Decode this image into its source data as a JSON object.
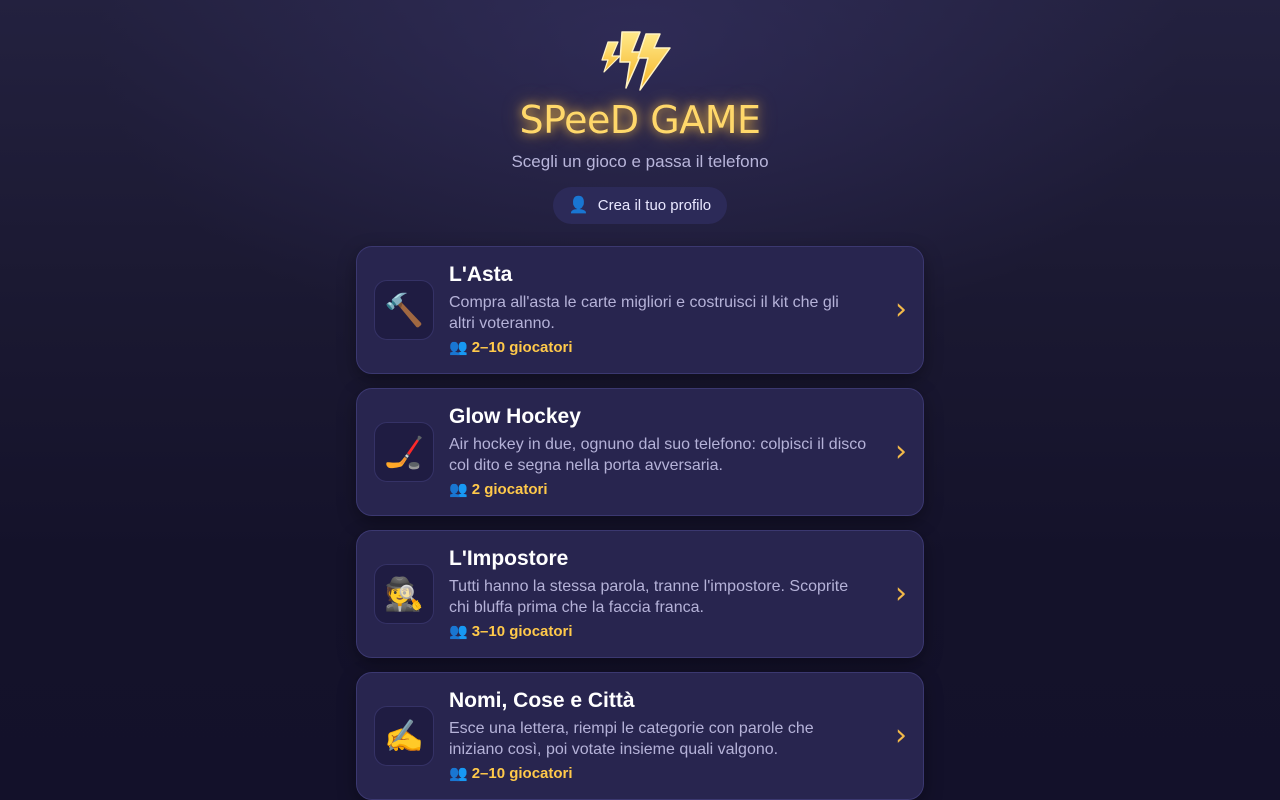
{
  "header": {
    "logo_icon": "lightning-bolt-icon",
    "title": "SPeeD GAME",
    "subtitle": "Scegli un gioco e passa il telefono",
    "accent_color": "#ffd86a"
  },
  "profile": {
    "icon": "👤",
    "label": "Crea il tuo profilo"
  },
  "games": [
    {
      "icon": "🔨",
      "icon_name": "hammer-icon",
      "title": "L'Asta",
      "description": "Compra all'asta le carte migliori e costruisci il kit che gli altri voteranno.",
      "players_icon": "👥",
      "players": "2–10 giocatori"
    },
    {
      "icon": "🏒",
      "icon_name": "hockey-stick-icon",
      "title": "Glow Hockey",
      "description": "Air hockey in due, ognuno dal suo telefono: colpisci il disco col dito e segna nella porta avversaria.",
      "players_icon": "👥",
      "players": "2 giocatori"
    },
    {
      "icon": "🕵️",
      "icon_name": "detective-icon",
      "title": "L'Impostore",
      "description": "Tutti hanno la stessa parola, tranne l'impostore. Scoprite chi bluffa prima che la faccia franca.",
      "players_icon": "👥",
      "players": "3–10 giocatori"
    },
    {
      "icon": "✍️",
      "icon_name": "writing-hand-icon",
      "title": "Nomi, Cose e Città",
      "description": "Esce una lettera, riempi le categorie con parole che iniziano così, poi votate insieme quali valgono.",
      "players_icon": "👥",
      "players": "2–10 giocatori"
    }
  ],
  "chevron": "›",
  "colors": {
    "background": "#1b1932",
    "card": "#28254f",
    "players_text": "#ffc94a",
    "chevron": "#f2b949"
  }
}
